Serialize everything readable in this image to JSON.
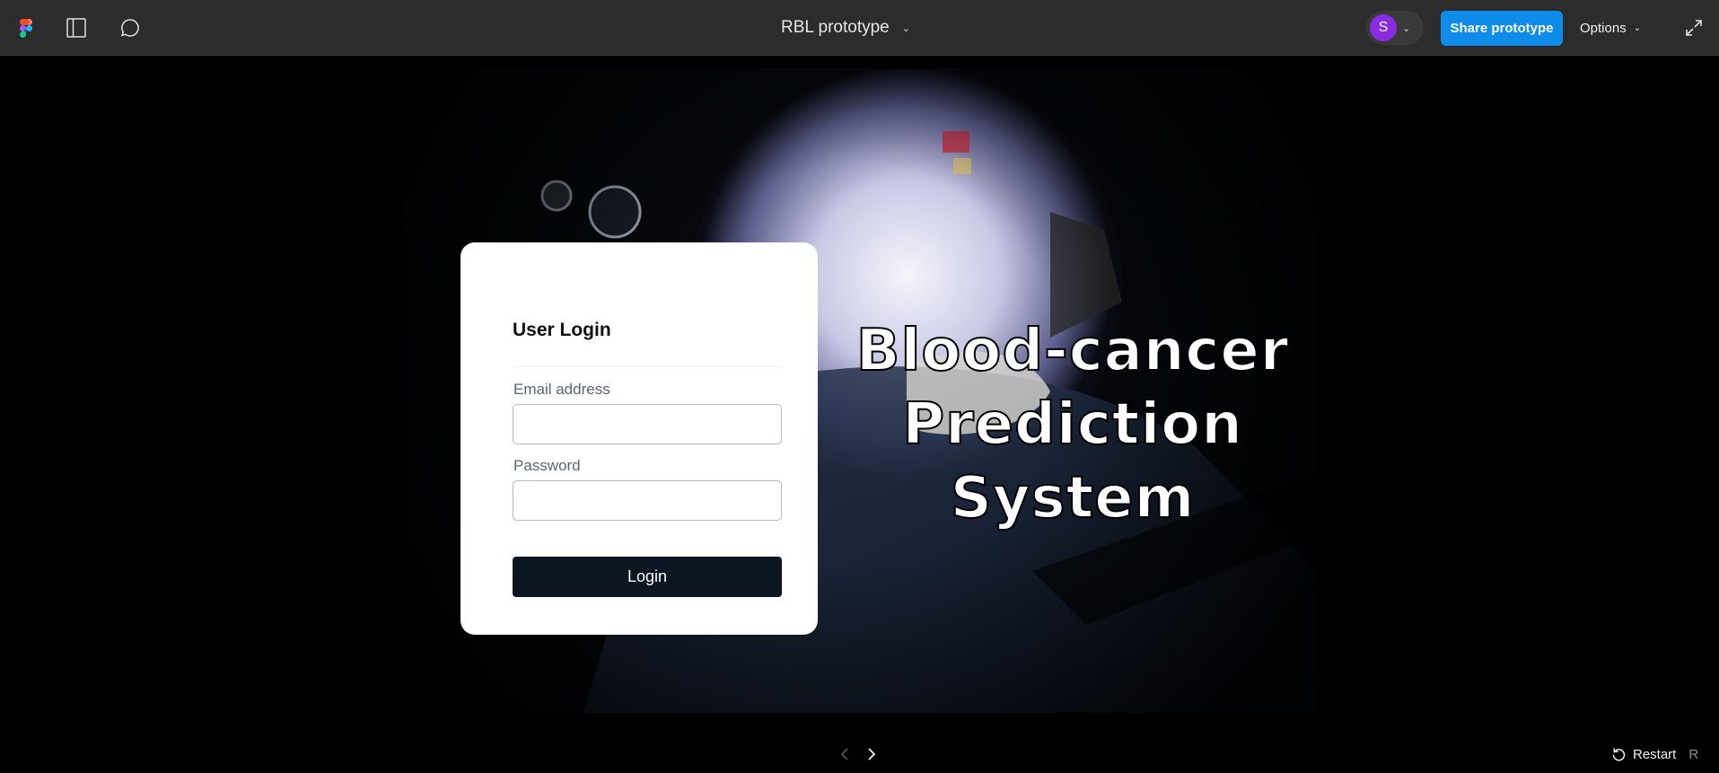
{
  "topbar": {
    "title": "RBL prototype",
    "title_chevron": "chevron-down-icon",
    "avatar_initial": "S",
    "avatar_color": "#8a2be2",
    "share_label": "Share prototype",
    "share_color": "#0d8ce9",
    "options_label": "Options",
    "icons": [
      "figma-logo-icon",
      "sidebar-toggle-icon",
      "comment-icon",
      "expand-icon"
    ]
  },
  "login": {
    "title": "User Login",
    "email_label": "Email address",
    "email_value": "",
    "password_label": "Password",
    "password_value": "",
    "button_label": "Login",
    "button_color": "#0c1622"
  },
  "hero": {
    "line1": "Blood-cancer",
    "line2": "Prediction",
    "line3": "System"
  },
  "footer": {
    "restart_label": "Restart",
    "restart_key": "R"
  }
}
